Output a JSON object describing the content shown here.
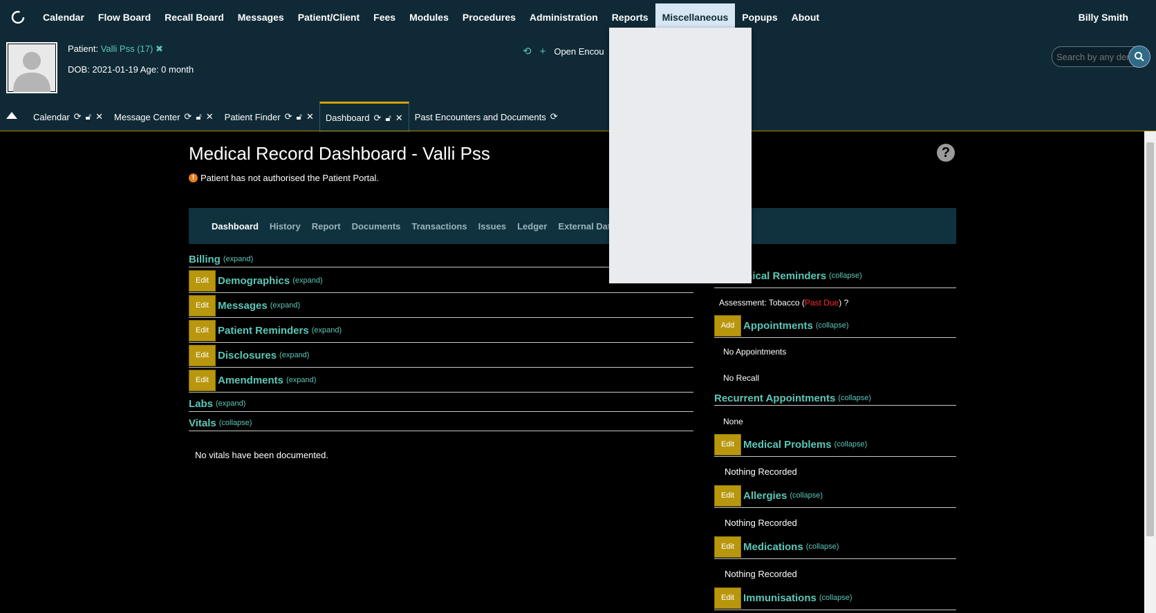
{
  "nav": {
    "items": [
      "Calendar",
      "Flow Board",
      "Recall Board",
      "Messages",
      "Patient/Client",
      "Fees",
      "Modules",
      "Procedures",
      "Administration",
      "Reports",
      "Miscellaneous",
      "Popups",
      "About"
    ],
    "active": "Miscellaneous",
    "user": "Billy Smith"
  },
  "patient": {
    "label": "Patient:",
    "name_link": "Valli Pss (17)",
    "dob_line": "DOB: 2021-01-19 Age: 0 month",
    "open_encounter": "Open Encou"
  },
  "search": {
    "placeholder": "Search by any demographics"
  },
  "tabs": [
    {
      "label": "Calendar"
    },
    {
      "label": "Message Center"
    },
    {
      "label": "Patient Finder"
    },
    {
      "label": "Dashboard"
    },
    {
      "label": "Past Encounters and Documents"
    }
  ],
  "main": {
    "title": "Medical Record Dashboard - Valli Pss",
    "warning": "Patient has not authorised the Patient Portal.",
    "subnav": [
      "Dashboard",
      "History",
      "Report",
      "Documents",
      "Transactions",
      "Issues",
      "Ledger",
      "External Data"
    ]
  },
  "left_sections": {
    "billing": {
      "title": "Billing",
      "toggle": "(expand)"
    },
    "demographics": {
      "title": "Demographics",
      "toggle": "(expand)",
      "btn": "Edit"
    },
    "messages": {
      "title": "Messages",
      "toggle": "(expand)",
      "btn": "Edit"
    },
    "reminders": {
      "title": "Patient Reminders",
      "toggle": "(expand)",
      "btn": "Edit"
    },
    "disclosures": {
      "title": "Disclosures",
      "toggle": "(expand)",
      "btn": "Edit"
    },
    "amendments": {
      "title": "Amendments",
      "toggle": "(expand)",
      "btn": "Edit"
    },
    "labs": {
      "title": "Labs",
      "toggle": "(expand)"
    },
    "vitals": {
      "title": "Vitals",
      "toggle": "(collapse)"
    },
    "vitals_body": "No vitals have been documented."
  },
  "right_sections": {
    "clinical": {
      "title": "inical Reminders",
      "toggle": "(collapse)"
    },
    "assessment": {
      "text": "Assessment: Tobacco",
      "status": "Past Due",
      "suffix": "?"
    },
    "appointments": {
      "title": "Appointments",
      "toggle": "(collapse)",
      "btn": "Add"
    },
    "no_appointments": "No Appointments",
    "no_recall": "No Recall",
    "recurrent": {
      "title": "Recurrent Appointments",
      "toggle": "(collapse)"
    },
    "recurrent_body": "None",
    "problems": {
      "title": "Medical Problems",
      "toggle": "(collapse)",
      "btn": "Edit"
    },
    "problems_body": "Nothing Recorded",
    "allergies": {
      "title": "Allergies",
      "toggle": "(collapse)",
      "btn": "Edit"
    },
    "allergies_body": "Nothing Recorded",
    "medications": {
      "title": "Medications",
      "toggle": "(collapse)",
      "btn": "Edit"
    },
    "medications_body": "Nothing Recorded",
    "immunisations": {
      "title": "Immunisations",
      "toggle": "(collapse)",
      "btn": "Edit"
    }
  },
  "colors": {
    "header_bg": "#0f2a36",
    "accent_teal": "#5cc7b8",
    "edit_button": "#b8970f",
    "past_due": "#ff2a2a"
  }
}
